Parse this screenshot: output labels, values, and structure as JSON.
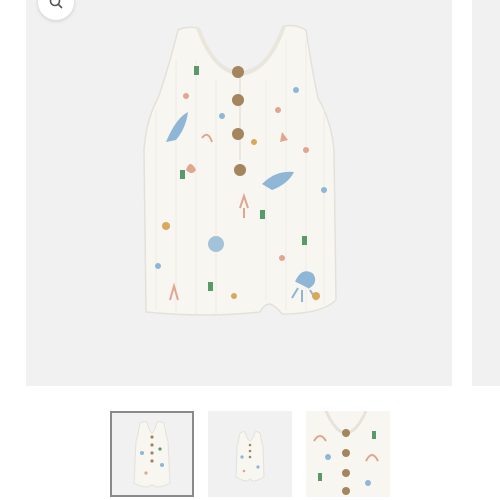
{
  "gallery": {
    "main_image": {
      "alt": "",
      "icon": "romper-image"
    },
    "zoom_button": {
      "icon": "magnifier-icon"
    },
    "thumbnails": [
      {
        "view": "front-full",
        "selected": true
      },
      {
        "view": "front-small",
        "selected": false
      },
      {
        "view": "detail-closeup",
        "selected": false
      }
    ]
  },
  "colors": {
    "background": "#f1f1f1",
    "fabric": "#f7f6f1",
    "button_wood": "#a4855e",
    "print_blue": "#8fb6d6",
    "print_coral": "#e2a58e",
    "print_green": "#5a9a6a",
    "thumb_border": "#8a8a8a"
  }
}
